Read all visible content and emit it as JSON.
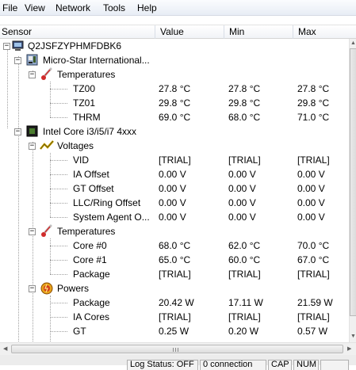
{
  "menu": [
    "File",
    "View",
    "Network",
    "Tools",
    "Help"
  ],
  "columns": [
    "Sensor",
    "Value",
    "Min",
    "Max"
  ],
  "tree": {
    "computer": "Q2JSFZYPHMFDBK6",
    "board": "Micro-Star International...",
    "board_temps": {
      "group": "Temperatures",
      "rows": [
        {
          "name": "TZ00",
          "value": "27.8 °C",
          "min": "27.8 °C",
          "max": "27.8 °C"
        },
        {
          "name": "TZ01",
          "value": "29.8 °C",
          "min": "29.8 °C",
          "max": "29.8 °C"
        },
        {
          "name": "THRM",
          "value": "69.0 °C",
          "min": "68.0 °C",
          "max": "71.0 °C"
        }
      ]
    },
    "cpu": "Intel Core i3/i5/i7 4xxx",
    "voltages": {
      "group": "Voltages",
      "rows": [
        {
          "name": "VID",
          "value": "[TRIAL]",
          "min": "[TRIAL]",
          "max": "[TRIAL]"
        },
        {
          "name": "IA Offset",
          "value": "0.00 V",
          "min": "0.00 V",
          "max": "0.00 V"
        },
        {
          "name": "GT Offset",
          "value": "0.00 V",
          "min": "0.00 V",
          "max": "0.00 V"
        },
        {
          "name": "LLC/Ring Offset",
          "value": "0.00 V",
          "min": "0.00 V",
          "max": "0.00 V"
        },
        {
          "name": "System Agent O...",
          "value": "0.00 V",
          "min": "0.00 V",
          "max": "0.00 V"
        }
      ]
    },
    "cpu_temps": {
      "group": "Temperatures",
      "rows": [
        {
          "name": "Core #0",
          "value": "68.0 °C",
          "min": "62.0 °C",
          "max": "70.0 °C"
        },
        {
          "name": "Core #1",
          "value": "65.0 °C",
          "min": "60.0 °C",
          "max": "67.0 °C"
        },
        {
          "name": "Package",
          "value": "[TRIAL]",
          "min": "[TRIAL]",
          "max": "[TRIAL]"
        }
      ]
    },
    "powers": {
      "group": "Powers",
      "rows": [
        {
          "name": "Package",
          "value": "20.42 W",
          "min": "17.11 W",
          "max": "21.59 W"
        },
        {
          "name": "IA Cores",
          "value": "[TRIAL]",
          "min": "[TRIAL]",
          "max": "[TRIAL]"
        },
        {
          "name": "GT",
          "value": "0.25 W",
          "min": "0.20 W",
          "max": "0.57 W"
        }
      ]
    }
  },
  "status": {
    "log": "Log Status: OFF",
    "connection": "0 connection",
    "caps": "CAP",
    "num": "NUM"
  },
  "icons": {
    "expand": "expand-icon",
    "computer": "computer-icon",
    "motherboard": "motherboard-icon",
    "cpu": "cpu-chip-icon",
    "thermometer": "thermometer-icon",
    "voltage": "voltage-icon",
    "power": "power-icon"
  }
}
